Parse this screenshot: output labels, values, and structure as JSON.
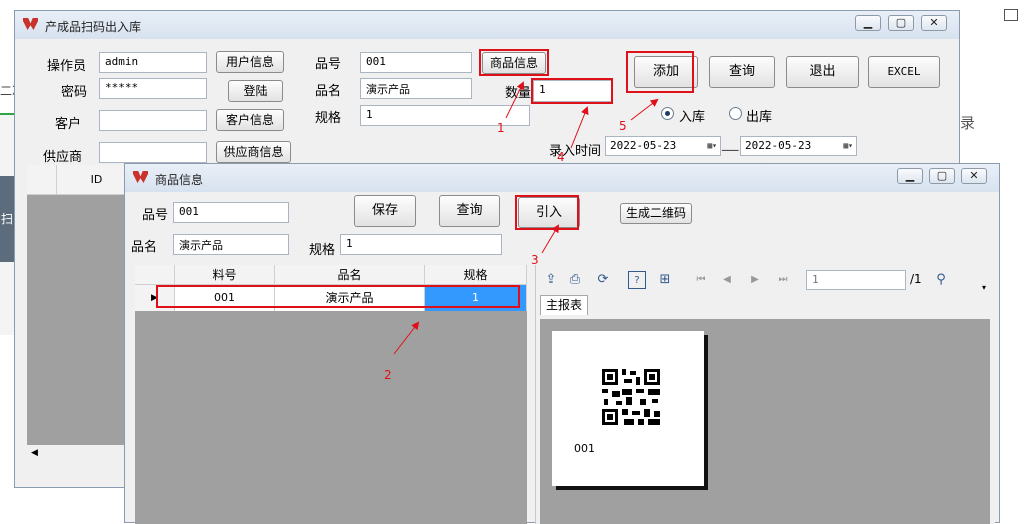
{
  "background": {
    "fragments": [
      "二次",
      "扫",
      "录"
    ]
  },
  "main_window": {
    "title": "产成品扫码出入库",
    "labels": {
      "operator": "操作员",
      "password": "密码",
      "customer": "客户",
      "supplier": "供应商",
      "item_no": "品号",
      "item_name": "品名",
      "spec": "规格",
      "quantity": "数量",
      "entry_time": "录入时间",
      "in": "入库",
      "out": "出库",
      "date_sep": "___"
    },
    "values": {
      "operator": "admin",
      "password": "*****",
      "customer": "",
      "supplier": "",
      "item_no": "001",
      "item_name": "演示产品",
      "spec": "1",
      "quantity": "1",
      "date_from": "2022-05-23",
      "date_to": "2022-05-23"
    },
    "buttons": {
      "user_info": "用户信息",
      "login": "登陆",
      "customer_info": "客户信息",
      "supplier_info": "供应商信息",
      "product_info": "商品信息",
      "add": "添加",
      "query": "查询",
      "exit": "退出",
      "excel": "EXCEL"
    },
    "selected_direction": "入库",
    "grid_header": "ID"
  },
  "product_window": {
    "title": "商品信息",
    "labels": {
      "item_no": "品号",
      "item_name": "品名",
      "spec": "规格"
    },
    "values": {
      "item_no": "001",
      "item_name": "演示产品",
      "spec": "1"
    },
    "buttons": {
      "save": "保存",
      "query": "查询",
      "import": "引入",
      "gen_qr": "生成二维码"
    },
    "table": {
      "columns": [
        "料号",
        "品名",
        "规格"
      ],
      "rows": [
        [
          "001",
          "演示产品",
          "1"
        ]
      ]
    },
    "report": {
      "page_input": "1",
      "page_total": "/1",
      "tab": "主报表",
      "qr_caption": "001"
    }
  },
  "annotations": [
    "1",
    "2",
    "3",
    "4",
    "5"
  ],
  "colors": {
    "highlight": "#e0101a",
    "selected_cell": "#3399ff",
    "grid_bg": "#a0a0a0"
  }
}
